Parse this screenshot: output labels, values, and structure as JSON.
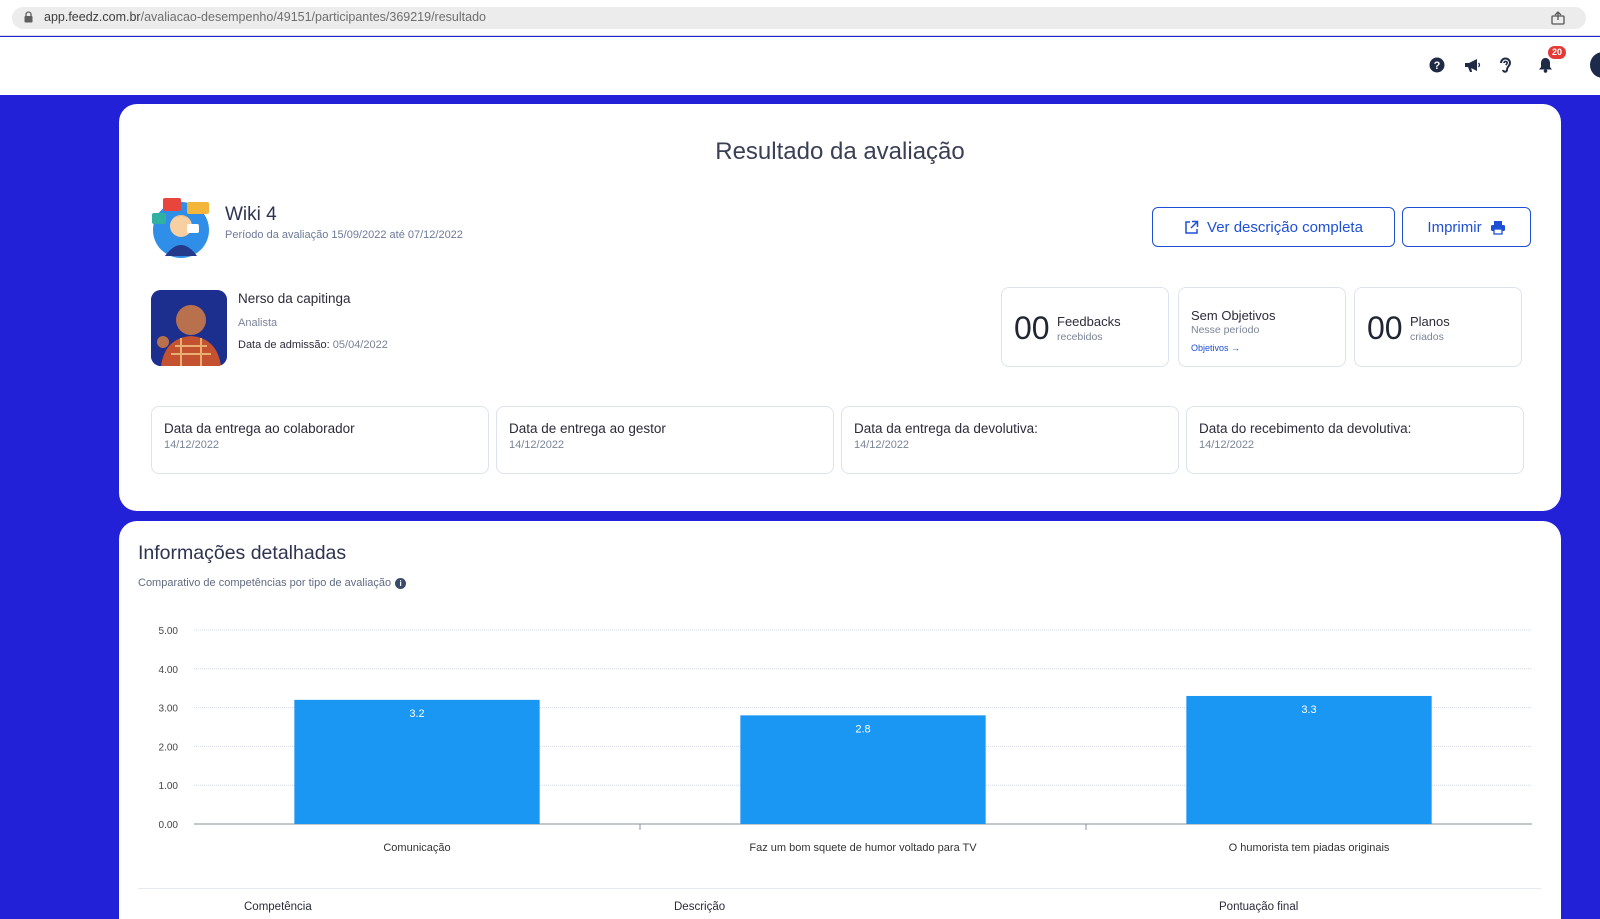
{
  "browser": {
    "url_host": "app.feedz.com.br",
    "url_path": "/avaliacao-desempenho/49151/participantes/369219/resultado"
  },
  "header": {
    "icons": [
      "help-icon",
      "megaphone-icon",
      "ear-icon",
      "bell-icon"
    ],
    "notification_count": "20"
  },
  "result": {
    "title": "Resultado da avaliação",
    "evaluation_name": "Wiki 4",
    "period": "Período da avaliação 15/09/2022 até 07/12/2022",
    "btn_description": "Ver descrição completa",
    "btn_print": "Imprimir"
  },
  "person": {
    "name": "Nerso da capitinga",
    "role": "Analista",
    "admission_label": "Data de admissão:",
    "admission_date": "05/04/2022"
  },
  "stats": {
    "feedbacks_count": "00",
    "feedbacks_label": "Feedbacks",
    "feedbacks_sub": "recebidos",
    "objectives_title": "Sem Objetivos",
    "objectives_sub": "Nesse período",
    "objectives_link": "Objetivos",
    "plans_count": "00",
    "plans_label": "Planos",
    "plans_sub": "criados"
  },
  "dates": [
    {
      "label": "Data da entrega ao colaborador",
      "value": "14/12/2022"
    },
    {
      "label": "Data de entrega ao gestor",
      "value": "14/12/2022"
    },
    {
      "label": "Data da entrega da devolutiva:",
      "value": "14/12/2022"
    },
    {
      "label": "Data do recebimento da devolutiva:",
      "value": "14/12/2022"
    }
  ],
  "details": {
    "title": "Informações detalhadas",
    "subtitle": "Comparativo de competências por tipo de avaliação"
  },
  "table": {
    "headers": [
      "Competência",
      "Descrição",
      "Pontuação final"
    ]
  },
  "colors": {
    "background": "#2321d8",
    "accent": "#1e4fd6",
    "bar": "#1a96f3"
  },
  "chart_data": {
    "type": "bar",
    "categories": [
      "Comunicação",
      "Faz um bom squete de humor voltado para TV",
      "O humorista tem piadas originais"
    ],
    "values": [
      3.2,
      2.8,
      3.3
    ],
    "value_labels": [
      "3.2",
      "2.8",
      "3.3"
    ],
    "y_ticks": [
      "0.00",
      "1.00",
      "2.00",
      "3.00",
      "4.00",
      "5.00"
    ],
    "ylim": [
      0,
      5
    ],
    "grid": true,
    "title": "",
    "xlabel": "",
    "ylabel": ""
  }
}
